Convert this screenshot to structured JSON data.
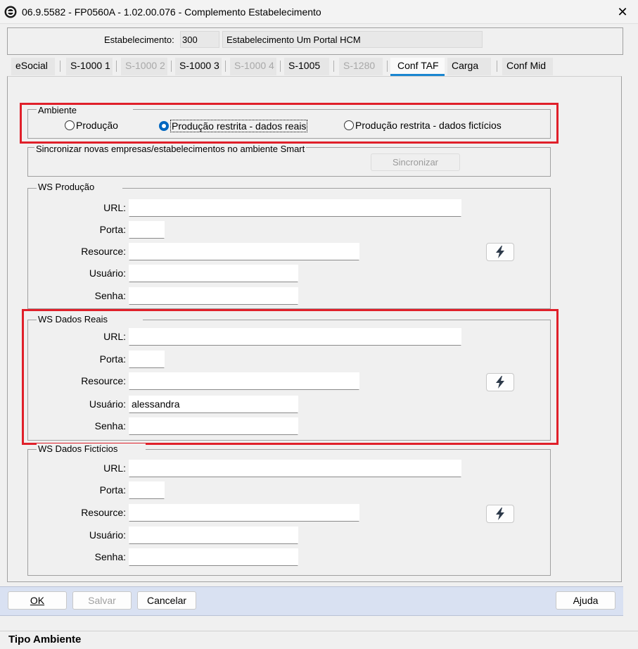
{
  "window": {
    "title": "06.9.5582 - FP0560A - 1.02.00.076 - Complemento Estabelecimento",
    "close_symbol": "✕"
  },
  "header": {
    "estab_label": "Estabelecimento:",
    "estab_code": "300",
    "estab_name": "Estabelecimento Um Portal HCM"
  },
  "tabs": [
    {
      "label": "eSocial",
      "state": "enabled"
    },
    {
      "label": "S-1000 1",
      "state": "enabled"
    },
    {
      "label": "S-1000 2",
      "state": "disabled"
    },
    {
      "label": "S-1000 3",
      "state": "enabled"
    },
    {
      "label": "S-1000 4",
      "state": "disabled"
    },
    {
      "label": "S-1005",
      "state": "enabled"
    },
    {
      "label": "S-1280",
      "state": "disabled"
    },
    {
      "label": "Conf TAF",
      "state": "active"
    },
    {
      "label": "Carga",
      "state": "enabled"
    },
    {
      "label": "Conf Mid",
      "state": "enabled"
    }
  ],
  "ambiente": {
    "legend": "Ambiente",
    "options": [
      {
        "label": "Produção",
        "checked": false
      },
      {
        "label": "Produção restrita - dados reais",
        "checked": true
      },
      {
        "label": "Produção restrita - dados fictícios",
        "checked": false
      }
    ]
  },
  "sincronizar": {
    "legend": "Sincronizar novas empresas/estabelecimentos no ambiente Smart",
    "button_label": "Sincronizar"
  },
  "ws_producao": {
    "legend": "WS Produção",
    "url_label": "URL:",
    "url_value": "",
    "porta_label": "Porta:",
    "porta_value": "",
    "resource_label": "Resource:",
    "resource_value": "",
    "usuario_label": "Usuário:",
    "usuario_value": "",
    "senha_label": "Senha:",
    "senha_value": "",
    "test_icon": "lightning-bolt-icon"
  },
  "ws_dados_reais": {
    "legend": "WS Dados Reais",
    "url_label": "URL:",
    "url_value": "",
    "porta_label": "Porta:",
    "porta_value": "",
    "resource_label": "Resource:",
    "resource_value": "",
    "usuario_label": "Usuário:",
    "usuario_value": "alessandra",
    "senha_label": "Senha:",
    "senha_value": "",
    "test_icon": "lightning-bolt-icon"
  },
  "ws_dados_ficticios": {
    "legend": "WS Dados Fictícios",
    "url_label": "URL:",
    "url_value": "",
    "porta_label": "Porta:",
    "porta_value": "",
    "resource_label": "Resource:",
    "resource_value": "",
    "usuario_label": "Usuário:",
    "usuario_value": "",
    "senha_label": "Senha:",
    "senha_value": "",
    "test_icon": "lightning-bolt-icon"
  },
  "footer": {
    "ok_label": "OK",
    "salvar_label": "Salvar",
    "cancelar_label": "Cancelar",
    "ajuda_label": "Ajuda"
  },
  "status": {
    "text": "Tipo Ambiente"
  },
  "colors": {
    "highlight": "#e0202a",
    "tab_active_underline": "#1a86d0",
    "radio_checked": "#0067c0",
    "bottom_bar": "#d9e1f2"
  }
}
